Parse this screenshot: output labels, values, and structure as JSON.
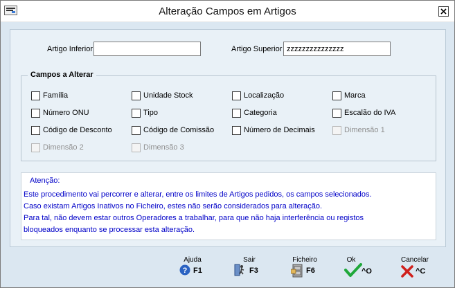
{
  "window": {
    "title": "Alteração Campos em Artigos"
  },
  "filters": {
    "lower_label": "Artigo Inferior",
    "lower_value": "",
    "upper_label": "Artigo Superior",
    "upper_value": "zzzzzzzzzzzzzzz"
  },
  "group": {
    "title": "Campos a Alterar",
    "items": [
      {
        "label": "Família",
        "checked": false,
        "enabled": true
      },
      {
        "label": "Unidade Stock",
        "checked": false,
        "enabled": true
      },
      {
        "label": "Localização",
        "checked": false,
        "enabled": true
      },
      {
        "label": "Marca",
        "checked": false,
        "enabled": true
      },
      {
        "label": "Número ONU",
        "checked": false,
        "enabled": true
      },
      {
        "label": "Tipo",
        "checked": false,
        "enabled": true
      },
      {
        "label": "Categoria",
        "checked": false,
        "enabled": true
      },
      {
        "label": "Escalão do IVA",
        "checked": false,
        "enabled": true
      },
      {
        "label": "Código de Desconto",
        "checked": false,
        "enabled": true
      },
      {
        "label": "Código de Comissão",
        "checked": false,
        "enabled": true
      },
      {
        "label": "Número de Decimais",
        "checked": false,
        "enabled": true
      },
      {
        "label": "Dimensão 1",
        "checked": false,
        "enabled": false
      },
      {
        "label": "Dimensão 2",
        "checked": false,
        "enabled": false
      },
      {
        "label": "Dimensão 3",
        "checked": false,
        "enabled": false
      }
    ]
  },
  "notice": {
    "heading": "Atenção:",
    "lines": [
      "Este procedimento vai percorrer e alterar,  entre os limites de Artigos pedidos, os campos selecionados.",
      "Caso existam Artigos Inativos no Ficheiro, estes não serão considerados para alteração.",
      "Para tal, não devem estar outros Operadores a trabalhar, para que não haja interferência ou registos",
      "bloqueados enquanto se processar esta alteração."
    ]
  },
  "toolbar": {
    "help": {
      "label": "Ajuda",
      "key": "F1",
      "icon": "help-icon"
    },
    "exit": {
      "label": "Sair",
      "key": "F3",
      "icon": "exit-icon"
    },
    "file": {
      "label": "Ficheiro",
      "key": "F6",
      "icon": "file-cabinet-icon"
    },
    "ok": {
      "label": "Ok",
      "key": "^O",
      "icon": "checkmark-icon"
    },
    "cancel": {
      "label": "Cancelar",
      "key": "^C",
      "icon": "cross-icon"
    }
  },
  "colors": {
    "notice_text": "#0000c8",
    "ok_green": "#1fa83a",
    "cancel_red": "#d0201c",
    "help_blue": "#2a62c2"
  }
}
